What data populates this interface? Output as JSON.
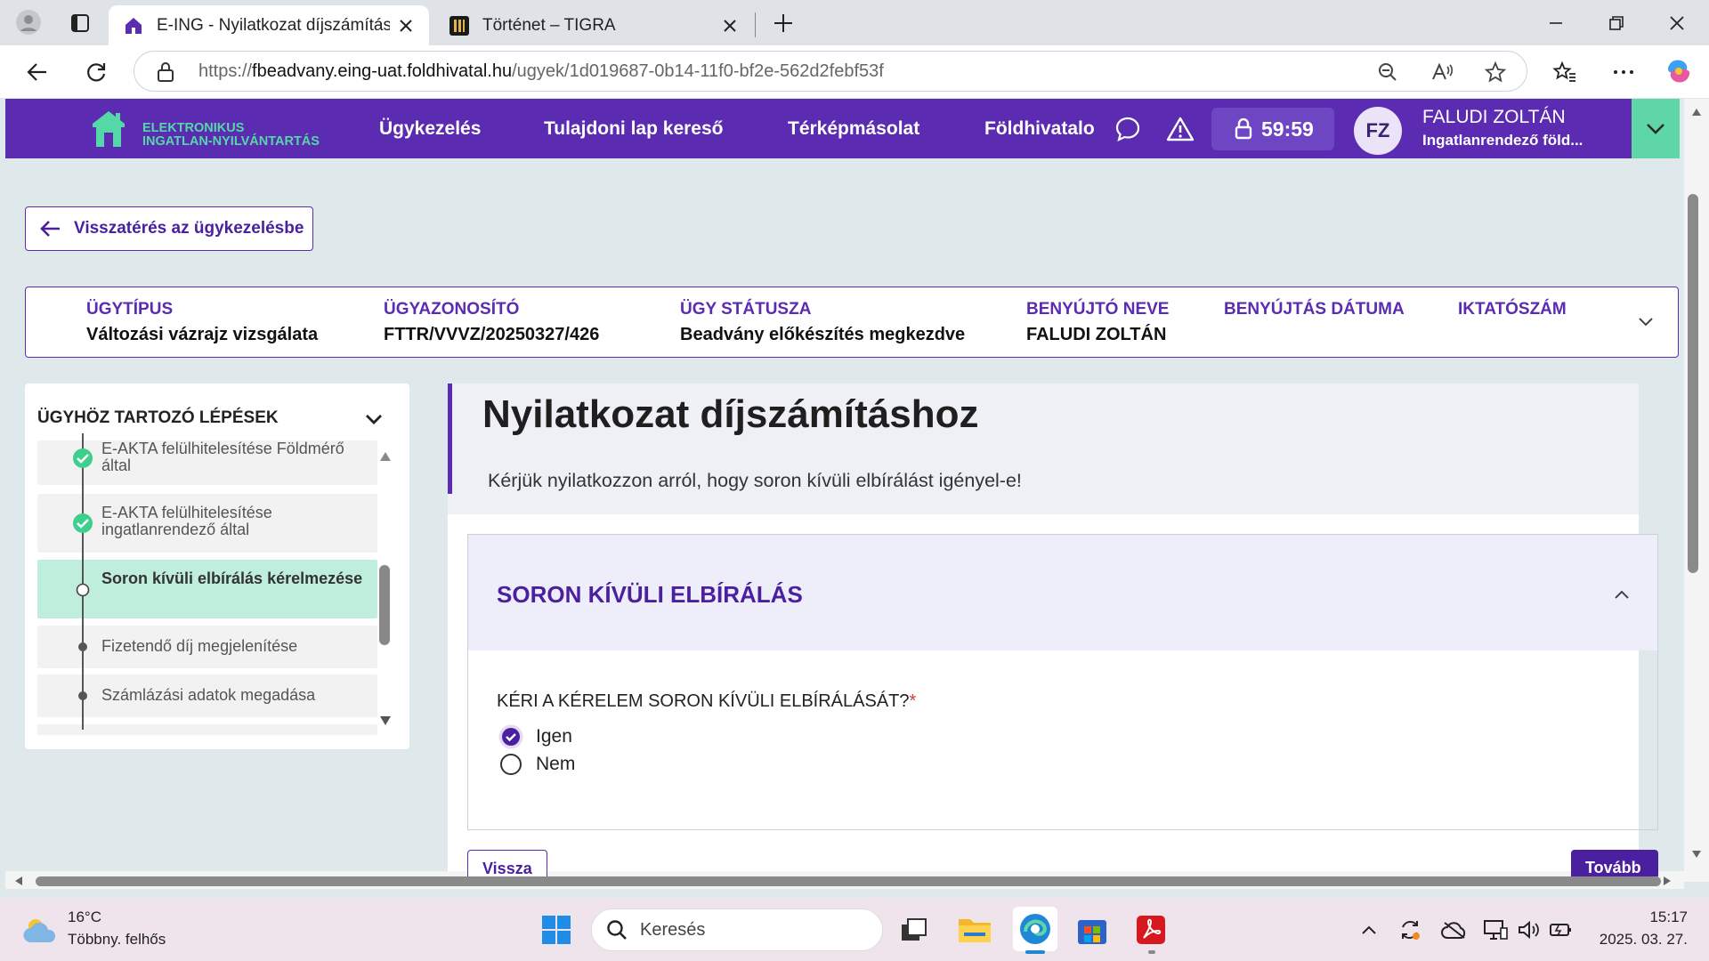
{
  "browser": {
    "tabs": [
      {
        "title": "E-ING - Nyilatkozat díjszámításhoz",
        "active": true
      },
      {
        "title": "Történet – TIGRA",
        "active": false
      }
    ],
    "url_prefix": "https://",
    "url_host": "fbeadvany.eing-uat.foldhivatal.hu",
    "url_path": "/ugyek/1d019687-0b14-11f0-bf2e-562d2febf53f"
  },
  "header": {
    "logo_line1": "ELEKTRONIKUS",
    "logo_line2": "INGATLAN-NYILVÁNTARTÁS",
    "nav": [
      "Ügykezelés",
      "Tulajdoni lap kereső",
      "Térképmásolat",
      "Földhivatalo"
    ],
    "timer": "59:59",
    "avatar_initials": "FZ",
    "user_name": "FALUDI ZOLTÁN",
    "user_role": "Ingatlanrendező föld..."
  },
  "back_button": "Visszatérés az ügykezelésbe",
  "info": [
    {
      "label": "ÜGYTÍPUS",
      "value": "Változási vázrajz vizsgálata"
    },
    {
      "label": "ÜGYAZONOSÍTÓ",
      "value": "FTTR/VVVZ/20250327/426"
    },
    {
      "label": "ÜGY STÁTUSZA",
      "value": "Beadvány előkészítés megkezdve"
    },
    {
      "label": "BENYÚJTÓ NEVE",
      "value": "FALUDI ZOLTÁN"
    },
    {
      "label": "BENYÚJTÁS DÁTUMA",
      "value": ""
    },
    {
      "label": "IKTATÓSZÁM",
      "value": ""
    }
  ],
  "steps": {
    "title": "ÜGYHÖZ TARTOZÓ LÉPÉSEK",
    "items": [
      {
        "label": "E-AKTA felülhitelesítése Földmérő által",
        "state": "done"
      },
      {
        "label": "E-AKTA felülhitelesítése ingatlanrendező által",
        "state": "done"
      },
      {
        "label": "Soron kívüli elbírálás kérelmezése",
        "state": "current"
      },
      {
        "label": "Fizetendő díj megjelenítése",
        "state": "pending"
      },
      {
        "label": "Számlázási adatok megadása",
        "state": "pending"
      }
    ]
  },
  "main": {
    "title": "Nyilatkozat díjszámításhoz",
    "subtitle": "Kérjük nyilatkozzon arról, hogy soron kívüli elbírálást igényel-e!",
    "section_title": "SORON KÍVÜLI ELBÍRÁLÁS",
    "question": "KÉRI A KÉRELEM SORON KÍVÜLI ELBÍRÁLÁSÁT?",
    "required_mark": "*",
    "options": [
      {
        "label": "Igen",
        "selected": true
      },
      {
        "label": "Nem",
        "selected": false
      }
    ],
    "back_label": "Vissza",
    "next_label": "Tovább"
  },
  "taskbar": {
    "weather_temp": "16°C",
    "weather_desc": "Többny. felhős",
    "search_placeholder": "Keresés",
    "time": "15:17",
    "date": "2025. 03. 27."
  },
  "colors": {
    "brand_purple": "#5b2bb2",
    "accent_green": "#5fd6a7",
    "active_step": "#bfeedd"
  }
}
